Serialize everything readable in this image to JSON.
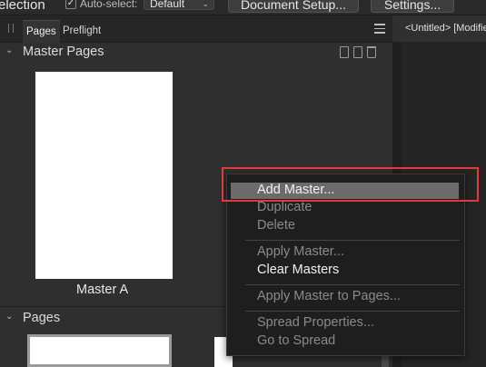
{
  "toolbar": {
    "selection_text": "election",
    "auto_select_label": "Auto-select:",
    "auto_select_value": "Default",
    "document_setup_label": "Document Setup...",
    "settings_label": "Settings..."
  },
  "panel": {
    "tabs": [
      {
        "label": "Pages"
      },
      {
        "label": "Preflight"
      }
    ],
    "master_pages": {
      "title": "Master Pages",
      "items": [
        {
          "label": "Master A"
        }
      ]
    },
    "pages": {
      "title": "Pages"
    }
  },
  "document": {
    "tab_title": "<Untitled> [Modified]"
  },
  "context_menu": {
    "items": [
      {
        "label": "Add Master...",
        "enabled": true
      },
      {
        "label": "Duplicate",
        "enabled": false
      },
      {
        "label": "Delete",
        "enabled": false
      },
      {
        "label": "Apply Master...",
        "enabled": false
      },
      {
        "label": "Clear Masters",
        "enabled": true
      },
      {
        "label": "Apply Master to Pages...",
        "enabled": false
      },
      {
        "label": "Spread Properties...",
        "enabled": false
      },
      {
        "label": "Go to Spread",
        "enabled": false
      }
    ]
  }
}
